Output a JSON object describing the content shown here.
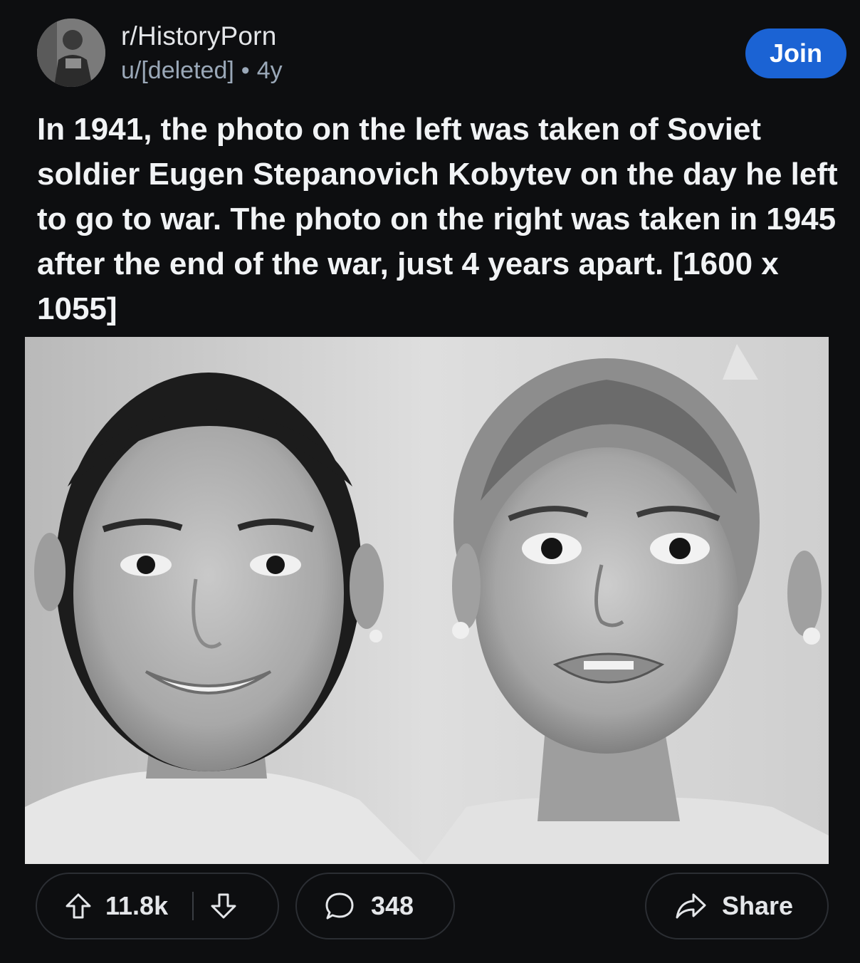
{
  "post": {
    "subreddit": "r/HistoryPorn",
    "author": "u/[deleted]",
    "separator": "•",
    "age": "4y",
    "join_label": "Join",
    "title": "In 1941, the photo on the left was taken of Soviet soldier Eugen Stepanovich Kobytev on the day he left to go to war. The photo on the right was taken in 1945 after the end of the war, just 4 years apart. [1600 x 1055]"
  },
  "actions": {
    "upvotes": "11.8k",
    "comments": "348",
    "share_label": "Share"
  },
  "icons": {
    "upvote": "arrow-up-icon",
    "downvote": "arrow-down-icon",
    "comment": "speech-bubble-icon",
    "share": "share-arrow-icon"
  },
  "colors": {
    "background": "#0d0e10",
    "join_button": "#1b63d4",
    "meta_text": "#9aa8b8"
  }
}
